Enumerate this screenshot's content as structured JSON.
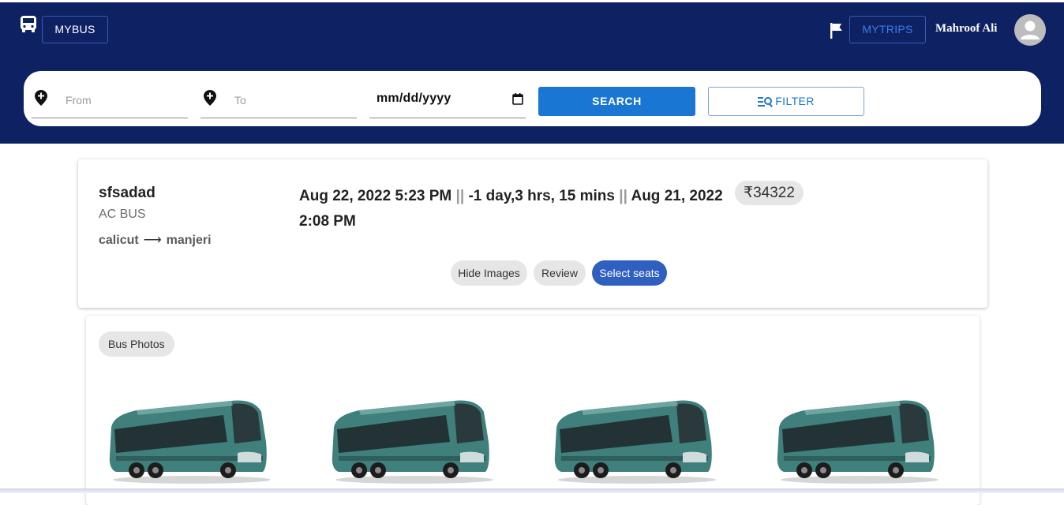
{
  "header": {
    "brand_label": "MYBUS",
    "mytrips_label": "MYTRIPS",
    "user_name": "Mahroof Ali",
    "icons": [
      "bus-icon",
      "flag-icon",
      "account-avatar-icon"
    ]
  },
  "search": {
    "from_placeholder": "From",
    "to_placeholder": "To",
    "date_value": "mm/dd/yyyy",
    "search_label": "SEARCH",
    "filter_label": "FILTER"
  },
  "trip": {
    "bus_name": "sfsadad",
    "bus_type": "AC BUS",
    "origin": "calicut",
    "destination": "manjeri",
    "departure": "Aug 22, 2022 5:23 PM",
    "duration": "-1 day,3 hrs, 15 mins",
    "arrival": "Aug 21, 2022 2:08 PM",
    "separator": "||",
    "price": "₹34322",
    "hide_images_label": "Hide Images",
    "review_label": "Review",
    "select_seats_label": "Select seats"
  },
  "photos": {
    "chip_label": "Bus Photos",
    "count": 4
  },
  "colors": {
    "header_bg": "#0d2163",
    "primary_button": "#1976d2",
    "select_seats_button": "#2f5fbf",
    "chip_bg": "#e6e6e6"
  }
}
